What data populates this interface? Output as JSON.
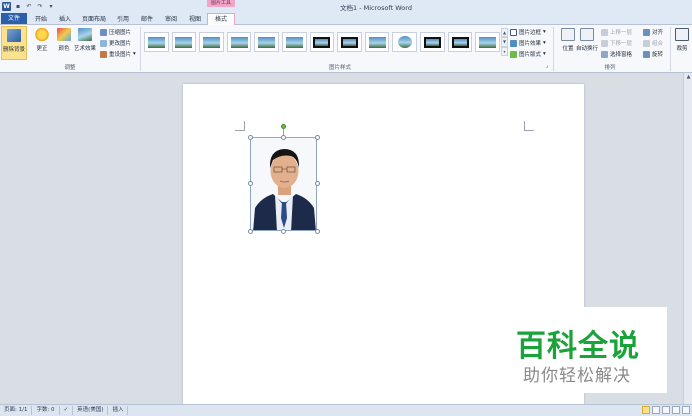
{
  "window": {
    "title": "文档1 - Microsoft Word",
    "quick_access": [
      "save-icon",
      "undo-icon",
      "redo-icon",
      "customize-icon"
    ],
    "contextual_tab_group": "图片工具"
  },
  "tabs": [
    {
      "label": "文件",
      "kind": "file"
    },
    {
      "label": "开始"
    },
    {
      "label": "插入"
    },
    {
      "label": "页面布局"
    },
    {
      "label": "引用"
    },
    {
      "label": "邮件"
    },
    {
      "label": "审阅"
    },
    {
      "label": "视图"
    },
    {
      "label": "格式",
      "active": true
    }
  ],
  "ribbon": {
    "adjust": {
      "label": "调整",
      "remove_bg": "删除背景",
      "corrections": "更正",
      "color": "颜色",
      "artistic": "艺术效果",
      "compress": "压缩图片",
      "change": "更改图片",
      "reset": "重设图片"
    },
    "styles": {
      "label": "图片样式",
      "border": "图片边框",
      "effects": "图片效果",
      "layout": "图片版式"
    },
    "arrange": {
      "label": "排列",
      "position": "位置",
      "wrap": "自动换行",
      "bring_forward": "上移一层",
      "send_backward": "下移一层",
      "selection_pane": "选择窗格",
      "align": "对齐",
      "group": "组合",
      "rotate": "旋转"
    },
    "size": {
      "crop": "裁剪"
    }
  },
  "watermark": {
    "main": "百科全说",
    "sub": "助你轻松解决"
  },
  "statusbar": {
    "page": "页面: 1/1",
    "words": "字数: 0",
    "language": "英语(美国)",
    "mode": "插入"
  },
  "colors": {
    "file_tab": "#2b5fa7",
    "contextual_tab": "#f0a6c9",
    "watermark_green": "#1aa33a"
  }
}
